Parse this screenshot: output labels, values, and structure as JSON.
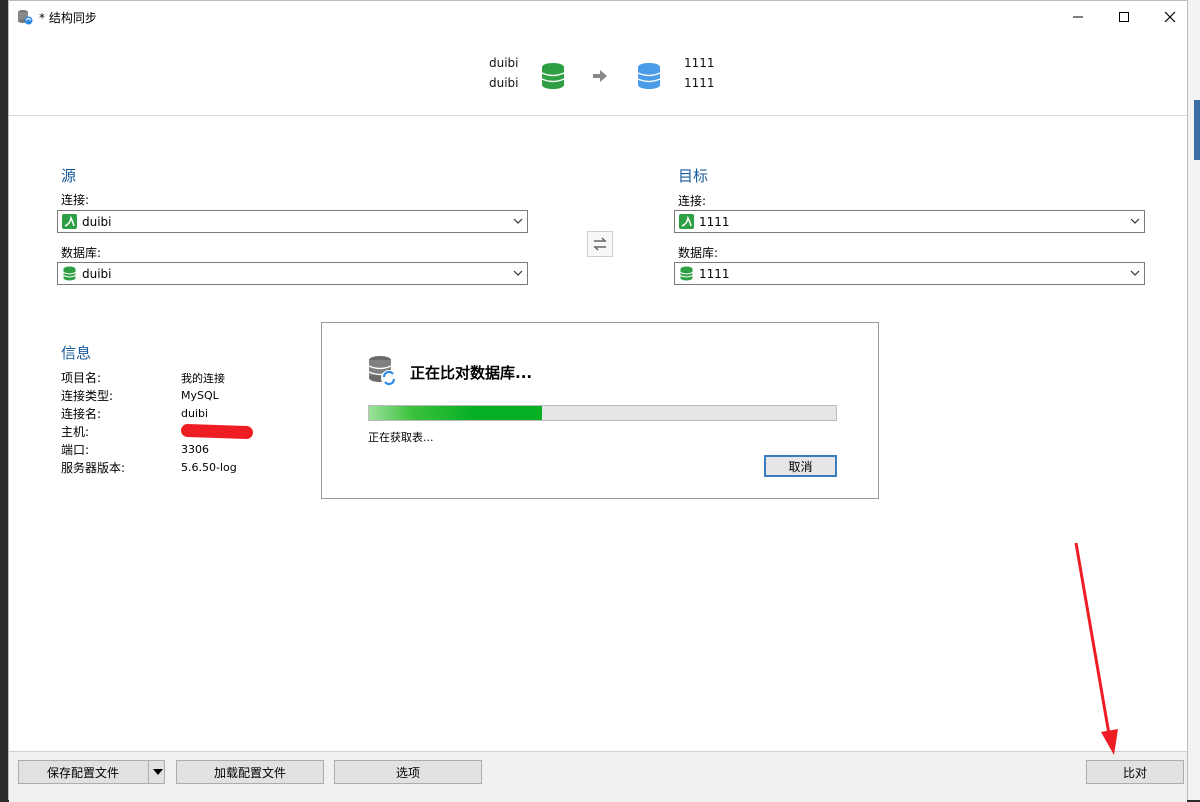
{
  "window": {
    "title": "* 结构同步"
  },
  "header": {
    "source_names": [
      "duibi",
      "duibi"
    ],
    "target_names": [
      "1111",
      "1111"
    ]
  },
  "source": {
    "section_title": "源",
    "connection_label": "连接:",
    "connection_value": "duibi",
    "database_label": "数据库:",
    "database_value": "duibi"
  },
  "target": {
    "section_title": "目标",
    "connection_label": "连接:",
    "connection_value": "1111",
    "database_label": "数据库:",
    "database_value": "1111"
  },
  "info": {
    "section_title": "信息",
    "rows": [
      {
        "key": "项目名:",
        "value": "我的连接"
      },
      {
        "key": "连接类型:",
        "value": "MySQL"
      },
      {
        "key": "连接名:",
        "value": "duibi"
      },
      {
        "key": "主机:",
        "value": ""
      },
      {
        "key": "端口:",
        "value": "3306"
      },
      {
        "key": "服务器版本:",
        "value": "5.6.50-log"
      }
    ]
  },
  "dialog": {
    "title": "正在比对数据库...",
    "status": "正在获取表...",
    "cancel_label": "取消",
    "progress": 0.37
  },
  "footer": {
    "save_config_label": "保存配置文件",
    "load_config_label": "加载配置文件",
    "options_label": "选项",
    "compare_label": "比对"
  },
  "colors": {
    "accent_title": "#1a5c9a",
    "source_db": "#2ea043",
    "target_db": "#4a9be8",
    "progress": "#06b025",
    "annotation_arrow": "#ee1d23"
  }
}
